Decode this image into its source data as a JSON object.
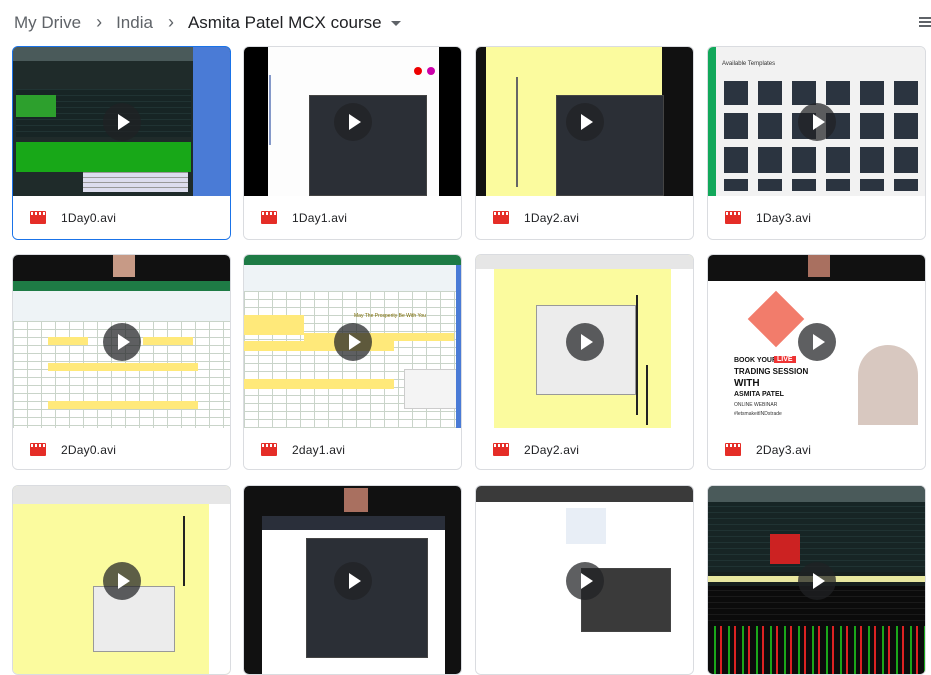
{
  "breadcrumb": {
    "items": [
      "My Drive",
      "India",
      "Asmita Patel MCX course"
    ],
    "separator": "›"
  },
  "files": [
    {
      "name": "1Day0.avi"
    },
    {
      "name": "1Day1.avi"
    },
    {
      "name": "1Day2.avi"
    },
    {
      "name": "1Day3.avi"
    },
    {
      "name": "2Day0.avi"
    },
    {
      "name": "2day1.avi"
    },
    {
      "name": "2Day2.avi"
    },
    {
      "name": "2Day3.avi"
    },
    {
      "name": ""
    },
    {
      "name": ""
    },
    {
      "name": ""
    },
    {
      "name": ""
    }
  ],
  "thumb_text": {
    "day0_header": "Available Templates",
    "day3_book": "BOOK YOUR",
    "day3_live": "LIVE",
    "day3_trading": "TRADING SESSION",
    "day3_with": "WITH",
    "day3_name": "ASMITA PATEL",
    "day3_webinar": "ONLINE WEBINAR",
    "day3_tag": "#letsmakeitINDstrade",
    "excel_banner": "May The Prosperity Be With You"
  },
  "colors": {
    "accent": "#1a73e8",
    "video_icon": "#e52d27",
    "text": "#202124",
    "muted": "#5f6368"
  }
}
